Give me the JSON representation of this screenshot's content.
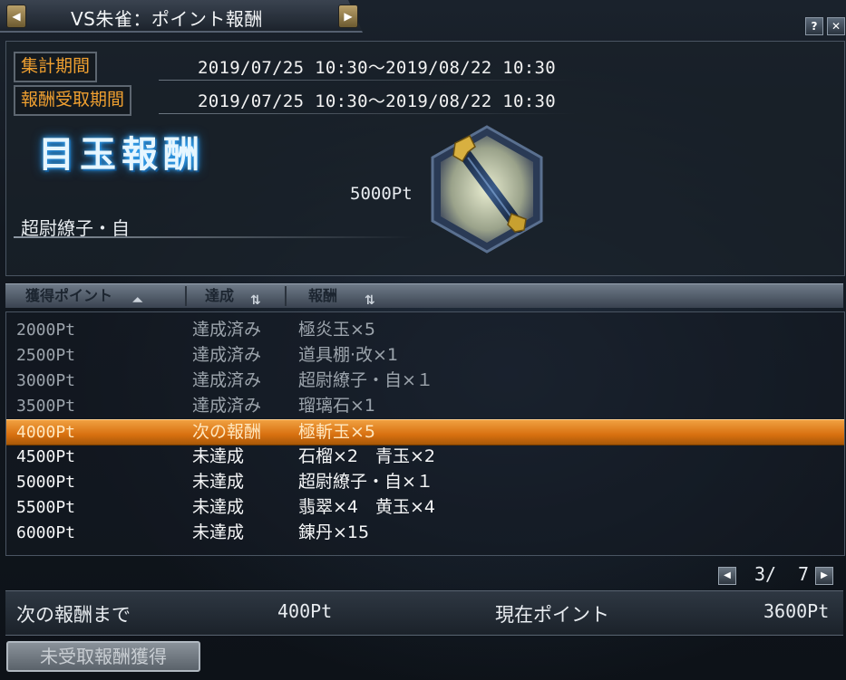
{
  "window": {
    "title": "VS朱雀：ポイント報酬",
    "help_label": "?",
    "close_label": "✕"
  },
  "periods": [
    {
      "label": "集計期間",
      "value": "2019/07/25 10:30～2019/08/22 10:30"
    },
    {
      "label": "報酬受取期間",
      "value": "2019/07/25 10:30～2019/08/22 10:30"
    }
  ],
  "featured": {
    "heading": "目玉報酬",
    "points": "5000Pt",
    "item_name": "超尉繚子・自"
  },
  "table": {
    "headers": [
      "獲得ポイント",
      "達成",
      "報酬"
    ],
    "rows": [
      {
        "points": "2000Pt",
        "status": "達成済み",
        "reward": "極炎玉×5",
        "state": "done"
      },
      {
        "points": "2500Pt",
        "status": "達成済み",
        "reward": "道具棚·改×1",
        "state": "done"
      },
      {
        "points": "3000Pt",
        "status": "達成済み",
        "reward": "超尉繚子・自×１",
        "state": "done"
      },
      {
        "points": "3500Pt",
        "status": "達成済み",
        "reward": "瑠璃石×1",
        "state": "done"
      },
      {
        "points": "4000Pt",
        "status": "次の報酬",
        "reward": "極斬玉×5",
        "state": "next"
      },
      {
        "points": "4500Pt",
        "status": "未達成",
        "reward": "石榴×2　青玉×2",
        "state": "todo"
      },
      {
        "points": "5000Pt",
        "status": "未達成",
        "reward": "超尉繚子・自×１",
        "state": "todo"
      },
      {
        "points": "5500Pt",
        "status": "未達成",
        "reward": "翡翠×4　黄玉×4",
        "state": "todo"
      },
      {
        "points": "6000Pt",
        "status": "未達成",
        "reward": "錬丹×15",
        "state": "todo"
      }
    ]
  },
  "pagination": {
    "current": "3/",
    "total": "7"
  },
  "footer": {
    "next_label": "次の報酬まで",
    "next_value": "400Pt",
    "current_label": "現在ポイント",
    "current_value": "3600Pt"
  },
  "claim_button": "未受取報酬獲得",
  "colors": {
    "accent_orange": "#f0a030",
    "highlight_row": "#d87010",
    "title_glow": "#3ab0ff"
  }
}
